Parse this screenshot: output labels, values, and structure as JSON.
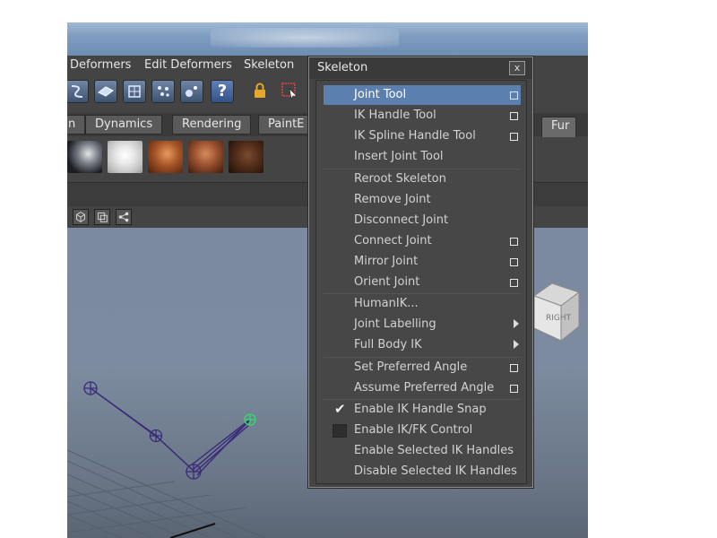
{
  "menubar": {
    "items": [
      "Deformers",
      "Edit Deformers",
      "Skeleton"
    ]
  },
  "toolbar": {
    "help_label": "?"
  },
  "shelf": {
    "tabs": [
      "n",
      "Dynamics",
      "Rendering",
      "PaintE",
      "Fur"
    ]
  },
  "viewcube": {
    "label": "RIGHT"
  },
  "popup": {
    "title": "Skeleton",
    "close_label": "x",
    "items": [
      {
        "label": "Joint Tool"
      },
      {
        "label": "IK Handle Tool"
      },
      {
        "label": "IK Spline Handle Tool"
      },
      {
        "label": "Insert Joint Tool"
      },
      {
        "label": "Reroot Skeleton"
      },
      {
        "label": "Remove Joint"
      },
      {
        "label": "Disconnect Joint"
      },
      {
        "label": "Connect Joint"
      },
      {
        "label": "Mirror Joint"
      },
      {
        "label": "Orient Joint"
      },
      {
        "label": "HumanIK..."
      },
      {
        "label": "Joint Labelling"
      },
      {
        "label": "Full Body IK"
      },
      {
        "label": "Set Preferred Angle"
      },
      {
        "label": "Assume Preferred Angle"
      },
      {
        "label": "Enable IK Handle Snap",
        "checked": true
      },
      {
        "label": "Enable IK/FK Control",
        "checked": false
      },
      {
        "label": "Enable Selected IK Handles"
      },
      {
        "label": "Disable Selected IK Handles"
      }
    ]
  },
  "colors": {
    "highlight": "#5b7fae",
    "joint": "#3a2a7a",
    "ik_handle": "#39d36a"
  }
}
